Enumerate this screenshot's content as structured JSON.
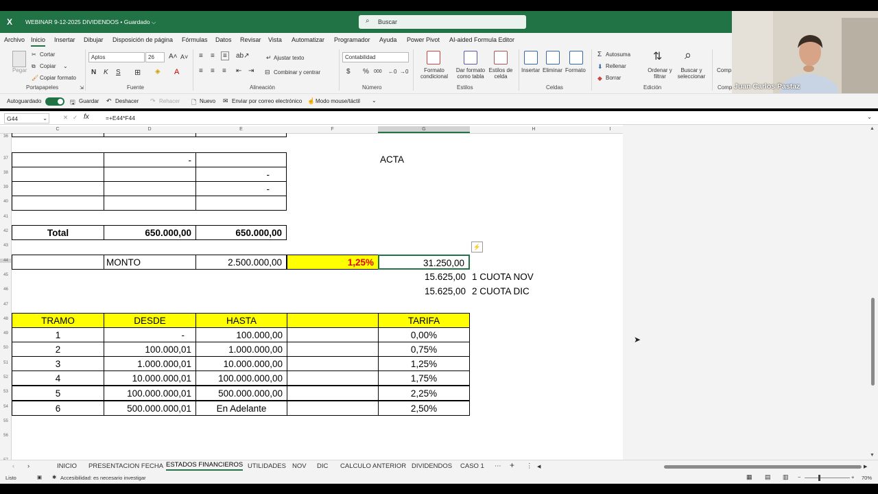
{
  "app": {
    "logo": "X",
    "title": "WEBINAR 9-12-2025 DIVIDENDOS • Guardado ⌵",
    "search_placeholder": "Buscar"
  },
  "menu": [
    "Archivo",
    "Inicio",
    "Insertar",
    "Dibujar",
    "Disposición de página",
    "Fórmulas",
    "Datos",
    "Revisar",
    "Vista",
    "Automatizar",
    "Programador",
    "Ayuda",
    "Power Pivot",
    "AI-aided Formula Editor"
  ],
  "ribbon": {
    "clipboard": {
      "paste": "Pegar",
      "cut": "Cortar",
      "copy": "Copiar",
      "format_painter": "Copiar formato",
      "group": "Portapapeles"
    },
    "font": {
      "name": "Aptos",
      "size": "26",
      "group": "Fuente",
      "bold": "N",
      "italic": "K",
      "underline": "S"
    },
    "alignment": {
      "wrap": "Ajustar texto",
      "merge": "Combinar y centrar",
      "group": "Alineación"
    },
    "number": {
      "format": "Contabilidad",
      "group": "Número",
      "currency": "$",
      "percent": "%",
      "thousands": "000"
    },
    "styles": {
      "cond": "Formato condicional",
      "table": "Dar formato como tabla",
      "cell": "Estilos de celda",
      "group": "Estilos"
    },
    "cells": {
      "insert": "Insertar",
      "delete": "Eliminar",
      "format": "Formato",
      "group": "Celdas"
    },
    "editing": {
      "autosum": "Autosuma",
      "fill": "Rellenar",
      "clear": "Borrar",
      "sort": "Ordenar y filtrar",
      "find": "Buscar y seleccionar",
      "group": "Edición"
    },
    "extra": {
      "label": "Comp",
      "group": "Comp"
    }
  },
  "qat": {
    "autosave": "Autoguardado",
    "save": "Guardar",
    "undo": "Deshacer",
    "redo": "Rehacer",
    "new": "Nuevo",
    "email": "Enviar por correo electrónico",
    "touch": "Modo mouse/táctil"
  },
  "formula_bar": {
    "cell": "G44",
    "formula": "=+E44*F44"
  },
  "columns": [
    "C",
    "D",
    "E",
    "F",
    "G",
    "H",
    "I"
  ],
  "rows": [
    "36",
    "37",
    "38",
    "39",
    "40",
    "41",
    "42",
    "43",
    "44",
    "45",
    "46",
    "47",
    "48",
    "49",
    "50",
    "51",
    "52",
    "53",
    "54",
    "55",
    "56",
    "57"
  ],
  "cells": {
    "acta": "ACTA",
    "d37": "-",
    "e38": "-",
    "e39": "-",
    "total_label": "Total",
    "total_d": "650.000,00",
    "total_e": "650.000,00",
    "monto_label": "MONTO",
    "monto_value": "2.500.000,00",
    "rate": "1,25%",
    "result": "31.250,00",
    "cuota1_val": "15.625,00",
    "cuota1_lbl": "1 CUOTA NOV",
    "cuota2_val": "15.625,00",
    "cuota2_lbl": "2 CUOTA DIC"
  },
  "table": {
    "headers": [
      "TRAMO",
      "DESDE",
      "HASTA",
      "",
      "TARIFA"
    ],
    "rows": [
      [
        "1",
        "-",
        "100.000,00",
        "",
        "0,00%"
      ],
      [
        "2",
        "100.000,01",
        "1.000.000,00",
        "",
        "0,75%"
      ],
      [
        "3",
        "1.000.000,01",
        "10.000.000,00",
        "",
        "1,25%"
      ],
      [
        "4",
        "10.000.000,01",
        "100.000.000,00",
        "",
        "1,75%"
      ],
      [
        "5",
        "100.000.000,01",
        "500.000.000,00",
        "",
        "2,25%"
      ],
      [
        "6",
        "500.000.000,01",
        "En Adelante",
        "",
        "2,50%"
      ]
    ]
  },
  "sheet_tabs": [
    "INICIO",
    "PRESENTACION FECHA",
    "ESTADOS FINANCIEROS",
    "UTILIDADES",
    "NOV",
    "DIC",
    "CALCULO ANTERIOR",
    "DIVIDENDOS",
    "CASO 1"
  ],
  "active_tab": "ESTADOS FINANCIEROS",
  "status": {
    "ready": "Listo",
    "accessibility": "Accesibilidad: es necesario investigar",
    "zoom": "70%"
  },
  "webcam": {
    "name": "Juan Carlos Pastaz"
  },
  "colors": {
    "excel_green": "#217346",
    "highlight_yellow": "#ffff00",
    "rate_red": "#e60000"
  }
}
